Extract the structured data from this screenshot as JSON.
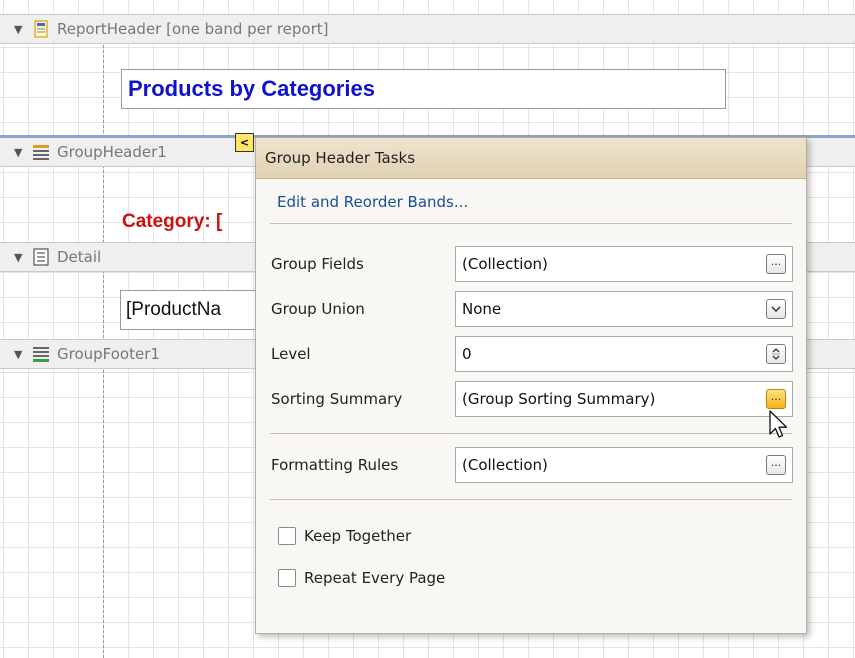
{
  "bands": {
    "report_header": {
      "label": "ReportHeader [one band per report]"
    },
    "group_header": {
      "label": "GroupHeader1"
    },
    "detail": {
      "label": "Detail"
    },
    "group_footer": {
      "label": "GroupFooter1"
    }
  },
  "controls": {
    "report_title": "Products by Categories",
    "category_label": "Category: [",
    "product_name": "[ProductNa"
  },
  "panel": {
    "title": "Group Header Tasks",
    "link": "Edit and Reorder Bands...",
    "properties": [
      {
        "label": "Group Fields",
        "value": "(Collection)",
        "button": "ellipsis-icon"
      },
      {
        "label": "Group Union",
        "value": "None",
        "button": "dropdown-arrow-icon"
      },
      {
        "label": "Level",
        "value": "0",
        "button": "spin-icon"
      },
      {
        "label": "Sorting Summary",
        "value": "(Group Sorting Summary)",
        "button": "ellipsis-icon"
      },
      {
        "label": "Formatting Rules",
        "value": "(Collection)",
        "button": "ellipsis-icon"
      }
    ],
    "checkboxes": [
      {
        "label": "Keep Together",
        "checked": false
      },
      {
        "label": "Repeat Every Page",
        "checked": false
      }
    ]
  },
  "colors": {
    "title_blue": "#1010d0",
    "category_red": "#cc1111",
    "link_blue": "#1b4f93",
    "panel_header": "#e0d1b2",
    "hot_button": "#f6b21b"
  }
}
